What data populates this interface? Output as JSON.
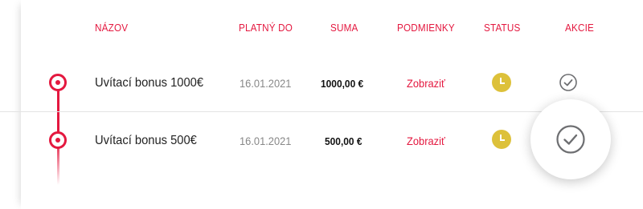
{
  "table": {
    "headers": {
      "name": "NÁZOV",
      "valid_until": "PLATNÝ DO",
      "amount": "SUMA",
      "conditions": "PODMIENKY",
      "status": "STATUS",
      "actions": "AKCIE"
    },
    "rows": [
      {
        "name": "Uvítací bonus 1000€",
        "valid_until": "16.01.2021",
        "amount": "1000,00 €",
        "conditions_link": "Zobraziť",
        "status_icon": "clock-icon",
        "action_icon": "check-circle-icon"
      },
      {
        "name": "Uvítací bonus 500€",
        "valid_until": "16.01.2021",
        "amount": "500,00 €",
        "conditions_link": "Zobraziť",
        "status_icon": "clock-icon",
        "action_icon": "check-circle-icon"
      }
    ]
  },
  "colors": {
    "accent": "#e4183f",
    "status_pending": "#ddc13a",
    "icon_gray": "#6d6e71"
  }
}
